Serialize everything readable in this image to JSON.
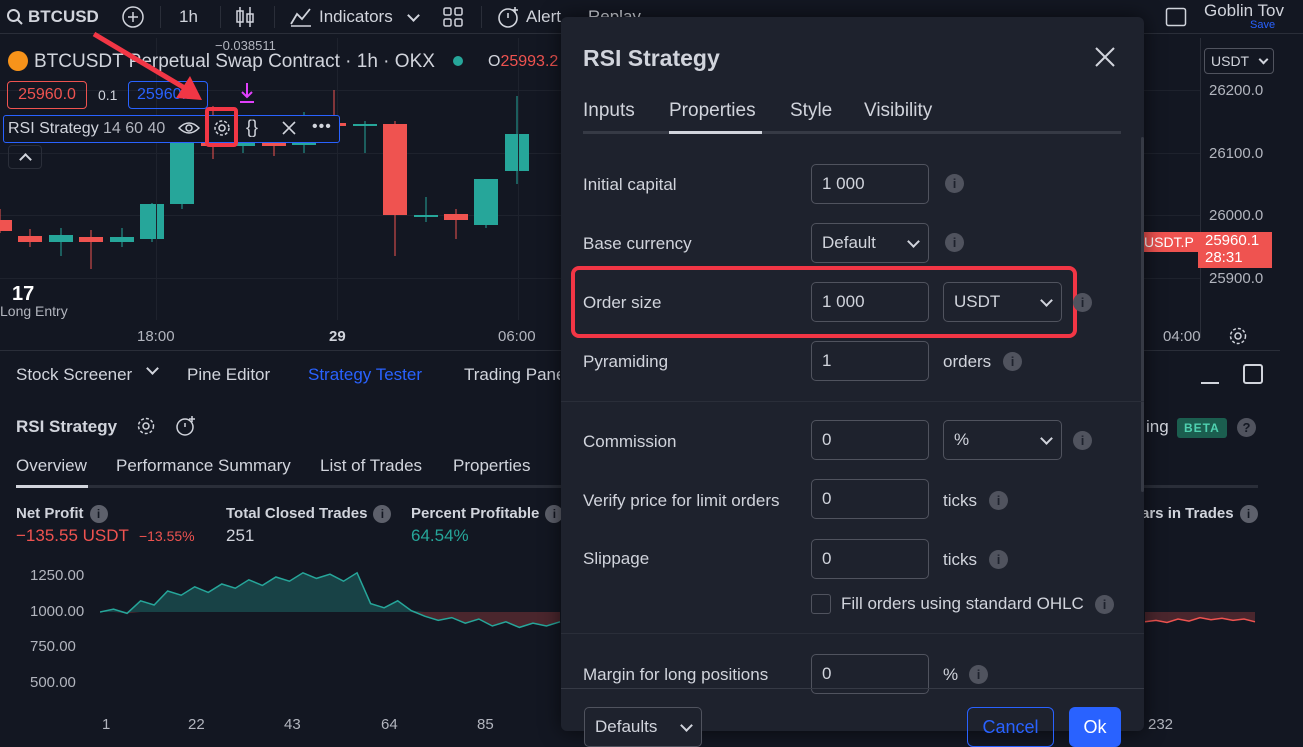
{
  "topbar": {
    "symbol": "BTCUSD",
    "interval": "1h",
    "indicators_label": "Indicators",
    "alert_label": "Alert",
    "replay_label": "Replay",
    "layout_name": "Goblin Tov",
    "save_label": "Save"
  },
  "chart": {
    "title": "BTCUSDT Perpetual Swap Contract · 1h · OKX",
    "last_price": "25993.2",
    "indicator_value": "−0.038511",
    "sell_price": "25960.0",
    "spread": "0.1",
    "buy_price": "25960.1",
    "indicator_name": "RSI Strategy",
    "indicator_params": "14 60 40",
    "trade_label": "Long Entry",
    "currency_select": "USDT",
    "symbol_tag": "USDT.P",
    "price_tag": "25960.1",
    "countdown": "28:31",
    "price_ticks": [
      "26200.0",
      "26100.0",
      "26000.0",
      "25900.0"
    ],
    "time_ticks": [
      "18:00",
      "29",
      "06:00",
      "04:00"
    ],
    "candles": [
      {
        "o": 25992,
        "h": 26010,
        "l": 25972,
        "c": 25975,
        "color": "red"
      },
      {
        "o": 25967,
        "h": 25978,
        "l": 25950,
        "c": 25958,
        "color": "red"
      },
      {
        "o": 25957,
        "h": 25980,
        "l": 25935,
        "c": 25968,
        "color": "green"
      },
      {
        "o": 25965,
        "h": 25976,
        "l": 25915,
        "c": 25957,
        "color": "red"
      },
      {
        "o": 25958,
        "h": 25980,
        "l": 25950,
        "c": 25965,
        "color": "green"
      },
      {
        "o": 25963,
        "h": 26020,
        "l": 25958,
        "c": 26018,
        "color": "green"
      },
      {
        "o": 26018,
        "h": 26160,
        "l": 26010,
        "c": 26130,
        "color": "green"
      },
      {
        "o": 26130,
        "h": 26175,
        "l": 26090,
        "c": 26110,
        "color": "red"
      },
      {
        "o": 26110,
        "h": 26140,
        "l": 26100,
        "c": 26125,
        "color": "green"
      },
      {
        "o": 26125,
        "h": 26160,
        "l": 26095,
        "c": 26110,
        "color": "red"
      },
      {
        "o": 26112,
        "h": 26165,
        "l": 26100,
        "c": 26148,
        "color": "green"
      },
      {
        "o": 26147,
        "h": 26200,
        "l": 26140,
        "c": 26142,
        "color": "red"
      },
      {
        "o": 26142,
        "h": 26150,
        "l": 26100,
        "c": 26145,
        "color": "green"
      },
      {
        "o": 26145,
        "h": 26150,
        "l": 25935,
        "c": 26000,
        "color": "red"
      },
      {
        "o": 26000,
        "h": 26030,
        "l": 25990,
        "c": 26000,
        "color": "green"
      },
      {
        "o": 26002,
        "h": 26010,
        "l": 25962,
        "c": 25992,
        "color": "red"
      },
      {
        "o": 25985,
        "h": 26040,
        "l": 25980,
        "c": 26058,
        "color": "green"
      },
      {
        "o": 26070,
        "h": 26190,
        "l": 26050,
        "c": 26130,
        "color": "green"
      }
    ]
  },
  "panel": {
    "tabs": [
      "Stock Screener",
      "Pine Editor",
      "Strategy Tester",
      "Trading Panel"
    ],
    "strategy_name": "RSI Strategy",
    "subtabs": [
      "Overview",
      "Performance Summary",
      "List of Trades",
      "Properties"
    ],
    "net_profit_title": "Net Profit",
    "net_profit_value": "−135.55 USDT",
    "net_profit_pct": "−13.55%",
    "total_closed_title": "Total Closed Trades",
    "total_closed_value": "251",
    "percent_profitable_title": "Percent Profitable",
    "percent_profitable_value": "64.54%",
    "bars_title": "ars in Trades",
    "ing_fragment": "ing",
    "beta_label": "BETA",
    "y_ticks": [
      "1250.00",
      "1000.00",
      "750.00",
      "500.00"
    ],
    "x_ticks": [
      "1",
      "22",
      "43",
      "64",
      "85",
      "232"
    ],
    "equity_curve": [
      1000,
      1020,
      990,
      1080,
      1050,
      1150,
      1120,
      1180,
      1140,
      1200,
      1170,
      1230,
      1190,
      1250,
      1220,
      1280,
      1240,
      1270,
      1220,
      1280,
      1060,
      1030,
      1080,
      1010,
      970,
      940,
      960,
      920,
      950,
      900,
      930,
      890,
      920,
      900,
      930
    ]
  },
  "dialog": {
    "title": "RSI Strategy",
    "tabs": [
      "Inputs",
      "Properties",
      "Style",
      "Visibility"
    ],
    "rows": {
      "initial_capital": {
        "label": "Initial capital",
        "value": "1 000"
      },
      "base_currency": {
        "label": "Base currency",
        "value": "Default"
      },
      "order_size": {
        "label": "Order size",
        "value": "1 000",
        "unit": "USDT"
      },
      "pyramiding": {
        "label": "Pyramiding",
        "value": "1",
        "unit": "orders"
      },
      "commission": {
        "label": "Commission",
        "value": "0",
        "unit": "%"
      },
      "verify_price": {
        "label": "Verify price for limit orders",
        "value": "0",
        "unit": "ticks"
      },
      "slippage": {
        "label": "Slippage",
        "value": "0",
        "unit": "ticks"
      },
      "fill_ohlc": {
        "label": "Fill orders using standard OHLC"
      },
      "margin_long": {
        "label": "Margin for long positions",
        "value": "0",
        "unit": "%"
      }
    },
    "defaults_label": "Defaults",
    "cancel_label": "Cancel",
    "ok_label": "Ok"
  },
  "colors": {
    "green": "#26a69a",
    "red": "#ef5350",
    "accent": "#2962ff",
    "highlight": "#f23645"
  }
}
